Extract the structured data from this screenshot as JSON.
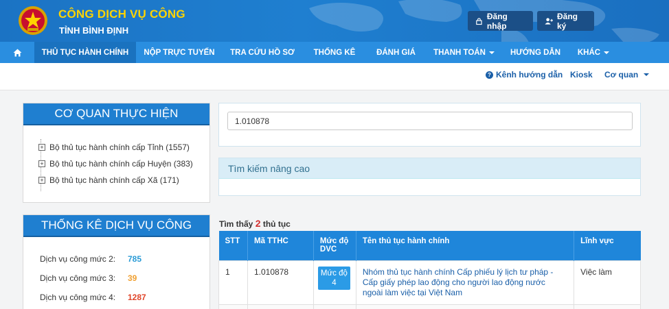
{
  "header": {
    "title": "CÔNG DỊCH VỤ CÔNG",
    "subtitle": "TỈNH BÌNH ĐỊNH",
    "login_label": "Đăng nhập",
    "register_label": "Đăng ký",
    "title_color": "#ffd400"
  },
  "nav": {
    "items": [
      {
        "label": "THỦ TỤC HÀNH CHÍNH"
      },
      {
        "label": "NỘP TRỰC TUYẾN"
      },
      {
        "label": "TRA CỨU HỒ SƠ"
      },
      {
        "label": "THỐNG KÊ"
      },
      {
        "label": "ĐÁNH GIÁ"
      },
      {
        "label": "THANH TOÁN"
      },
      {
        "label": "HƯỚNG DẪN"
      },
      {
        "label": "KHÁC"
      }
    ]
  },
  "subnav": {
    "guide": "Kênh hướng dẫn",
    "kiosk": "Kiosk",
    "agency": "Cơ quan"
  },
  "agencies": {
    "title": "CƠ QUAN THỰC HIỆN",
    "items": [
      {
        "label": "Bộ thủ tục hành chính cấp Tỉnh (1557)"
      },
      {
        "label": "Bộ thủ tục hành chính cấp Huyện (383)"
      },
      {
        "label": "Bộ thủ tục hành chính cấp Xã (171)"
      }
    ]
  },
  "stats": {
    "title": "THỐNG KÊ DỊCH VỤ CÔNG",
    "rows": [
      {
        "label": "Dịch vụ công mức 2:",
        "value": "785",
        "color": "#2a9bd6"
      },
      {
        "label": "Dịch vụ công mức 3:",
        "value": "39",
        "color": "#f0a030"
      },
      {
        "label": "Dịch vụ công mức 4:",
        "value": "1287",
        "color": "#e0452a"
      }
    ]
  },
  "search": {
    "value": "1.010878",
    "advanced_label": "Tìm kiếm nâng cao"
  },
  "results": {
    "prefix": "Tìm thấy",
    "count": "2",
    "suffix": "thủ tục",
    "columns": [
      "STT",
      "Mã TTHC",
      "Mức độ DVC",
      "Tên thủ tục hành chính",
      "Lĩnh vực"
    ],
    "rows": [
      {
        "stt": "1",
        "code": "1.010878",
        "level": "Mức độ 4",
        "name": "Nhóm thủ tục hành chính Cấp phiếu lý lịch tư pháp - Cấp giấy phép lao động cho người lao động nước ngoài làm việc tại Việt Nam",
        "field": "Việc làm"
      }
    ]
  }
}
